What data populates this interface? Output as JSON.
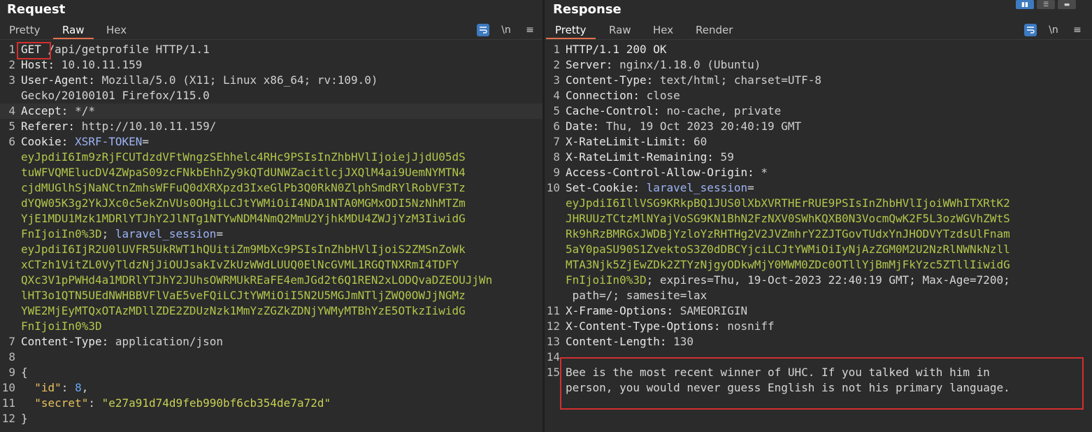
{
  "request": {
    "title": "Request",
    "tabs": [
      "Pretty",
      "Raw",
      "Hex"
    ],
    "active_tab": "Raw",
    "lines": [
      [
        "1",
        "GET /api/getprofile HTTP/1.1"
      ],
      [
        "2",
        "Host: 10.10.11.159"
      ],
      [
        "3",
        "User-Agent: Mozilla/5.0 (X11; Linux x86_64; rv:109.0)"
      ],
      [
        "",
        "Gecko/20100101 Firefox/115.0"
      ],
      [
        "4",
        "Accept: */*"
      ],
      [
        "5",
        "Referer: http://10.10.11.159/"
      ],
      [
        "6",
        "Cookie: XSRF-TOKEN="
      ],
      [
        "",
        "eyJpdiI6Im9zRjFCUTdzdVFtWngzSEhhelc4RHc9PSIsInZhbHVlIjoiejJjdU05dS"
      ],
      [
        "",
        "tuWFVQMElucDV4ZWpaS09zcFNkbEhhZy9kQTdUNWZacitlcjJXQlM4ai9UemNYMTN4"
      ],
      [
        "",
        "cjdMUGlhSjNaNCtnZmhsWFFuQ0dXRXpzd3IxeGlPb3Q0RkN0ZlphSmdRYlRobVF3Tz"
      ],
      [
        "",
        "dYQW05K3g2YkJXc0c5ekZnVUs0OHgiLCJtYWMiOiI4NDA1NTA0MGMxODI5NzNhMTZm"
      ],
      [
        "",
        "YjE1MDU1Mzk1MDRlYTJhY2JlNTg1NTYwNDM4NmQ2MmU2YjhkMDU4ZWJjYzM3IiwidG"
      ],
      [
        "",
        "FnIjoiIn0%3D; laravel_session="
      ],
      [
        "",
        "eyJpdiI6IjR2U0lUVFR5UkRWT1hQUitiZm9MbXc9PSIsInZhbHVlIjoiS2ZMSnZoWk"
      ],
      [
        "",
        "xCTzh1VitZL0VyTldzNjJiOUJsakIvZkUzWWdLUUQ0ElNcGVML1RGQTNXRmI4TDFY"
      ],
      [
        "",
        "QXc3V1pPWHd4a1MDRlYTJhY2JUhsOWRMUkREaFE4emJGd2t6Q1REN2xLODQvaDZEOUJjWn"
      ],
      [
        "",
        "lHT3o1QTN5UEdNWHBBVFlVaE5veFQiLCJtYWMiOiI5N2U5MGJmNTljZWQ0OWJjNGMz"
      ],
      [
        "",
        "YWE2MjEyMTQxOTAzMDllZDE2ZDUzNzk1MmYzZGZkZDNjYWMyMTBhYzE5OTkzIiwidG"
      ],
      [
        "",
        "FnIjoiIn0%3D"
      ],
      [
        "7",
        "Content-Type: application/json"
      ],
      [
        "8",
        ""
      ],
      [
        "9",
        "{"
      ],
      [
        "10",
        "  \"id\": 8,"
      ],
      [
        "11",
        "  \"secret\": \"e27a91d74d9feb990bf6cb354de7a72d\""
      ],
      [
        "12",
        "}"
      ]
    ]
  },
  "response": {
    "title": "Response",
    "tabs": [
      "Pretty",
      "Raw",
      "Hex",
      "Render"
    ],
    "active_tab": "Pretty",
    "lines": [
      [
        "1",
        "HTTP/1.1 200 OK"
      ],
      [
        "2",
        "Server: nginx/1.18.0 (Ubuntu)"
      ],
      [
        "3",
        "Content-Type: text/html; charset=UTF-8"
      ],
      [
        "4",
        "Connection: close"
      ],
      [
        "5",
        "Cache-Control: no-cache, private"
      ],
      [
        "6",
        "Date: Thu, 19 Oct 2023 20:40:19 GMT"
      ],
      [
        "7",
        "X-RateLimit-Limit: 60"
      ],
      [
        "8",
        "X-RateLimit-Remaining: 59"
      ],
      [
        "9",
        "Access-Control-Allow-Origin: *"
      ],
      [
        "10",
        "Set-Cookie: laravel_session="
      ],
      [
        "",
        "eyJpdiI6IllVSG9KRkpBQ1JUS0lXbXVRTHErRUE9PSIsInZhbHVlIjoiWWhITXRtK2"
      ],
      [
        "",
        "JHRUUzTCtzMlNYajVoSG9KN1BhN2FzNXV0SWhKQXB0N3VocmQwK2F5L3ozWGVhZWtS"
      ],
      [
        "",
        "Rk9hRzBMRGxJWDBjYzloYzRHTHg2V2JVZmhrY2ZJTGovTUdxYnJHODVYTzdsUlFnam"
      ],
      [
        "",
        "5aY0paSU90S1ZvektoS3Z0dDBCYjciLCJtYWMiOiIyNjAzZGM0M2U2NzRlNWNkNzll"
      ],
      [
        "",
        "MTA3Njk5ZjEwZDk2ZTYzNjgyODkwMjY0MWM0ZDc0OTllYjBmMjFkYzc5ZTllIiwidG"
      ],
      [
        "",
        "FnIjoiIn0%3D; expires=Thu, 19-Oct-2023 22:40:19 GMT; Max-Age=7200;"
      ],
      [
        "",
        " path=/; samesite=lax"
      ],
      [
        "11",
        "X-Frame-Options: SAMEORIGIN"
      ],
      [
        "12",
        "X-Content-Type-Options: nosniff"
      ],
      [
        "13",
        "Content-Length: 130"
      ],
      [
        "14",
        ""
      ],
      [
        "15",
        "Bee is the most recent winner of UHC. If you talked with him in"
      ],
      [
        "",
        "person, you would never guess English is not his primary language."
      ]
    ]
  },
  "toolbar": {
    "wrap_icon": "wrap-lines-icon",
    "newline_label": "\\n",
    "menu_icon": "hamburger-menu-icon"
  },
  "highlight_color": "#d32f2f",
  "accent_color": "#e2704a"
}
